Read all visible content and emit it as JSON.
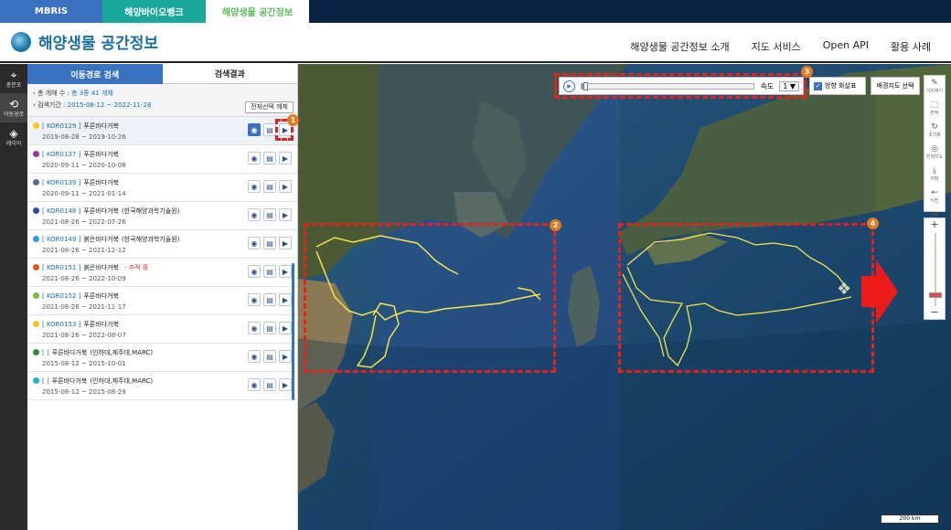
{
  "top_tabs": [
    "MBRIS",
    "해양바이오뱅크",
    "해양생물 공간정보"
  ],
  "header": {
    "title": "해양생물 공간정보",
    "nav": [
      "해양생물 공간정보 소개",
      "지도 서비스",
      "Open API",
      "활용 사례"
    ]
  },
  "rail": [
    {
      "icon": "map-pin-icon",
      "glyph": "⌖",
      "label": "종분포"
    },
    {
      "icon": "route-icon",
      "glyph": "⟲",
      "label": "이동경로"
    },
    {
      "icon": "layers-icon",
      "glyph": "◈",
      "label": "레이어"
    }
  ],
  "panel": {
    "tabs": [
      "이동경로 검색",
      "검색결과"
    ],
    "summary_count_label": "총 개체 수 :",
    "summary_count_value": "총 3종 41 개체",
    "summary_period_label": "검색기간 :",
    "summary_period_value": "2015-08-12 ~ 2022-11-28",
    "clear_button": "전체선택 해제"
  },
  "results": [
    {
      "color": "#f7c81e",
      "code": "[ KOR0129 ]",
      "name": "푸른바다거북",
      "org": "",
      "status": "",
      "dates": "2019-08-28 ~ 2019-10-26",
      "selected": true
    },
    {
      "color": "#8e3aa7",
      "code": "[ KOR0137 ]",
      "name": "푸른바다거북",
      "org": "",
      "status": "",
      "dates": "2020-09-11 ~ 2020-10-08",
      "selected": false
    },
    {
      "color": "#5a6f87",
      "code": "[ KOR0139 ]",
      "name": "푸른바다거북",
      "org": "",
      "status": "",
      "dates": "2020-09-11 ~ 2021-01-14",
      "selected": false
    },
    {
      "color": "#2f4aa8",
      "code": "[ KOR0148 ]",
      "name": "푸른바다거북",
      "org": "(한국해양과학기술원)",
      "status": "",
      "dates": "2021-08-26 ~ 2022-07-26",
      "selected": false
    },
    {
      "color": "#2d9be0",
      "code": "[ KOR0149 ]",
      "name": "붉은바다거북",
      "org": "(한국해양과학기술원)",
      "status": "",
      "dates": "2021-08-26 ~ 2021-12-12",
      "selected": false
    },
    {
      "color": "#e8531d",
      "code": "[ KOR0151 ]",
      "name": "붉은바다거북",
      "org": "",
      "status": "- 추적 중",
      "dates": "2021-08-26 ~ 2022-10-09",
      "selected": false
    },
    {
      "color": "#7cbf3f",
      "code": "[ KOR0152 ]",
      "name": "푸른바다거북",
      "org": "",
      "status": "",
      "dates": "2021-08-26 ~ 2021-11-17",
      "selected": false
    },
    {
      "color": "#f7c81e",
      "code": "[ KOR0153 ]",
      "name": "푸른바다거북",
      "org": "",
      "status": "",
      "dates": "2021-08-26 ~ 2022-08-07",
      "selected": false
    },
    {
      "color": "#2e8b3a",
      "code": "[ ]",
      "name": "푸른바다거북",
      "org": "(인하대,제주대,MARC)",
      "status": "",
      "dates": "2015-08-12 ~ 2015-10-01",
      "selected": false
    },
    {
      "color": "#27b3c7",
      "code": "[ ]",
      "name": "푸른바다거북",
      "org": "(인하대,제주대,MARC)",
      "status": "",
      "dates": "2015-08-12 ~ 2015-08-29",
      "selected": false
    }
  ],
  "playback": {
    "speed_label": "속도",
    "speed_value": "1 ▼",
    "progress": 0.02
  },
  "direction_label": "방향 화살표",
  "basemap_button": "배경지도 선택",
  "tools": [
    {
      "icon": "ruler-icon",
      "glyph": "✎",
      "label": "거리재기"
    },
    {
      "icon": "area-icon",
      "glyph": "⬚",
      "label": "면적"
    },
    {
      "icon": "refresh-icon",
      "glyph": "↻",
      "label": "초기화"
    },
    {
      "icon": "globe-icon",
      "glyph": "◎",
      "label": "전체지도"
    },
    {
      "icon": "save-icon",
      "glyph": "⤓",
      "label": "저장"
    },
    {
      "icon": "back-icon",
      "glyph": "←",
      "label": "이전"
    },
    {
      "icon": "forward-icon",
      "glyph": "→",
      "label": "다음"
    }
  ],
  "zoom": {
    "plus": "+",
    "minus": "−",
    "level": 0.85
  },
  "scale": "200 km",
  "badges": [
    "1",
    "2",
    "3",
    "4"
  ]
}
